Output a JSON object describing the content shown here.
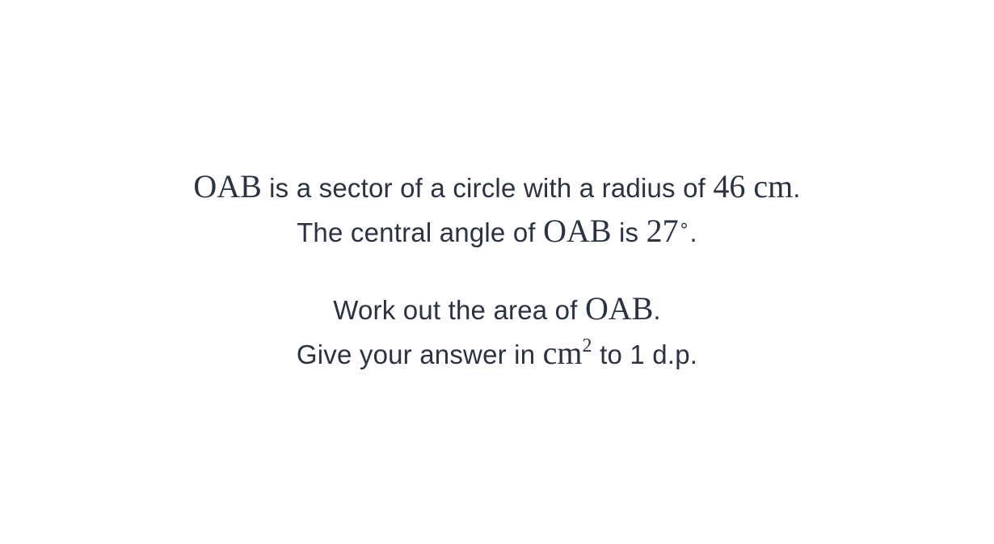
{
  "problem": {
    "line1": {
      "shape": "OAB",
      "text_a": " is a sector of a circle with a radius of ",
      "radius_value": "46",
      "radius_unit": " cm",
      "end": "."
    },
    "line2": {
      "text_a": "The central angle of ",
      "shape": "OAB",
      "text_b": " is ",
      "angle_value": "27",
      "angle_symbol": "∘",
      "end": "."
    },
    "line3": {
      "text_a": "Work out the area of ",
      "shape": "OAB",
      "end": "."
    },
    "line4": {
      "text_a": "Give your answer in ",
      "unit": "cm",
      "unit_power": "2",
      "text_b": " to 1 d.p."
    }
  }
}
